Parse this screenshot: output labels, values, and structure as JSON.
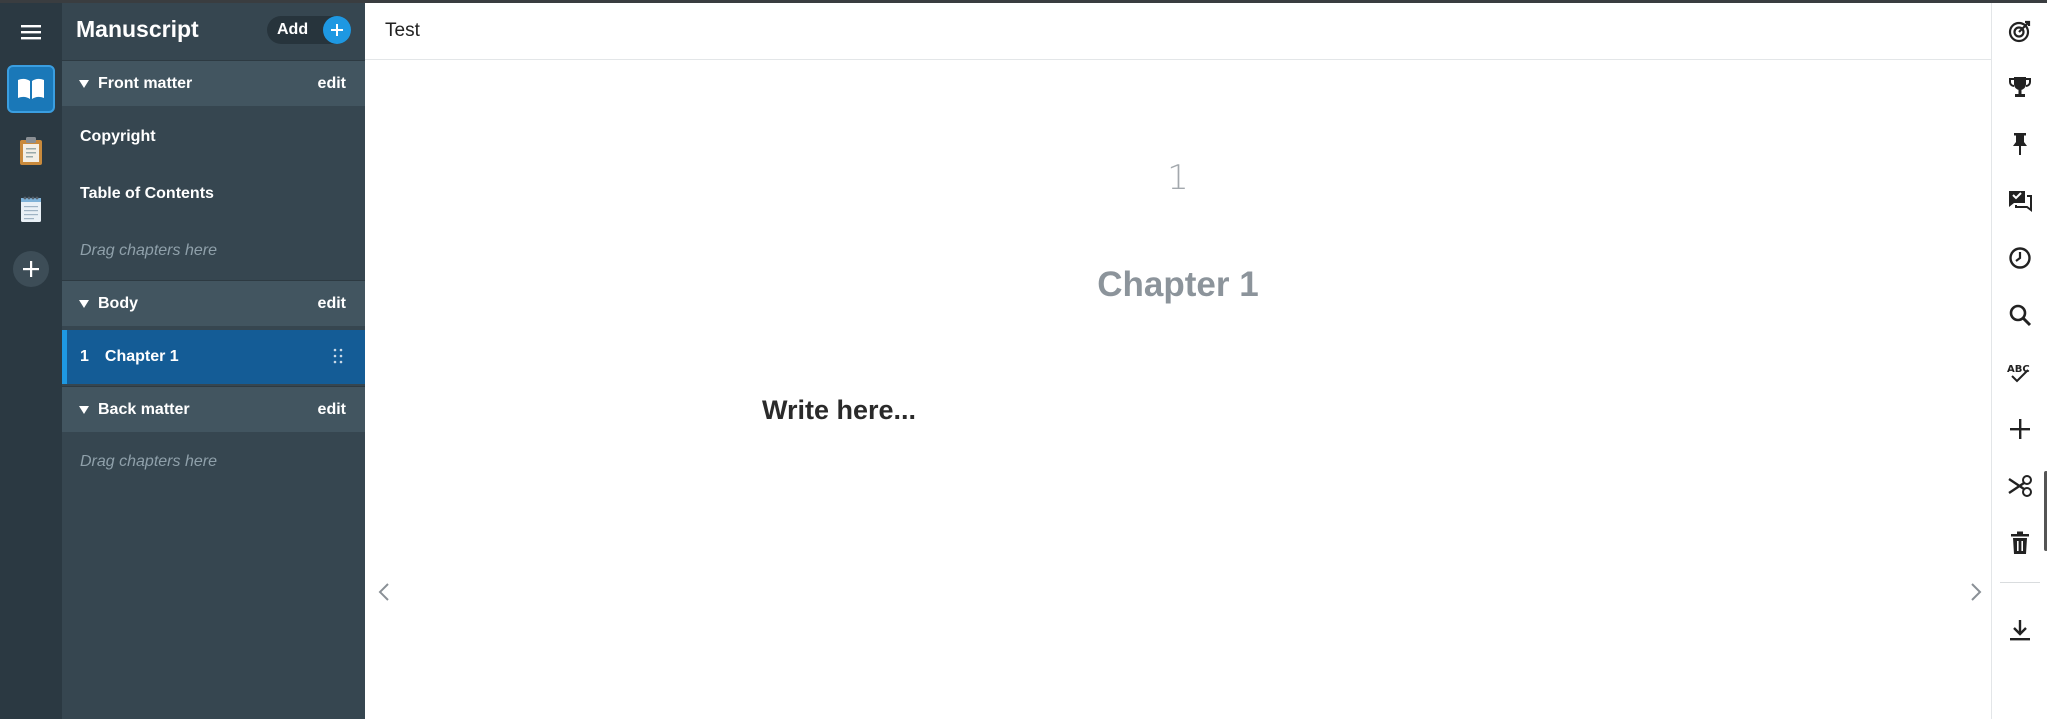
{
  "sidebar": {
    "title": "Manuscript",
    "add_label": "Add",
    "sections": {
      "front": {
        "label": "Front matter",
        "edit": "edit"
      },
      "body": {
        "label": "Body",
        "edit": "edit"
      },
      "back": {
        "label": "Back matter",
        "edit": "edit"
      }
    },
    "front_items": [
      "Copyright",
      "Table of Contents"
    ],
    "drag_hint": "Drag chapters here",
    "chapters": [
      {
        "number": "1",
        "title": "Chapter 1"
      }
    ]
  },
  "editor": {
    "document_title": "Test",
    "page_number": "1",
    "chapter_title": "Chapter 1",
    "placeholder": "Write here..."
  },
  "rail_icons": [
    "menu-icon",
    "book-icon",
    "clipboard-icon",
    "notepad-icon",
    "plus-icon"
  ],
  "toolbar_icons": [
    "target-icon",
    "trophy-icon",
    "pin-icon",
    "comments-icon",
    "clock-icon",
    "search-icon",
    "spellcheck-icon",
    "plus-icon",
    "scissors-icon",
    "trash-icon",
    "download-icon"
  ],
  "colors": {
    "rail": "#2b3942",
    "sidebar": "#364650",
    "section_header": "#425560",
    "selected": "#145c96",
    "accent": "#1e98e2"
  }
}
